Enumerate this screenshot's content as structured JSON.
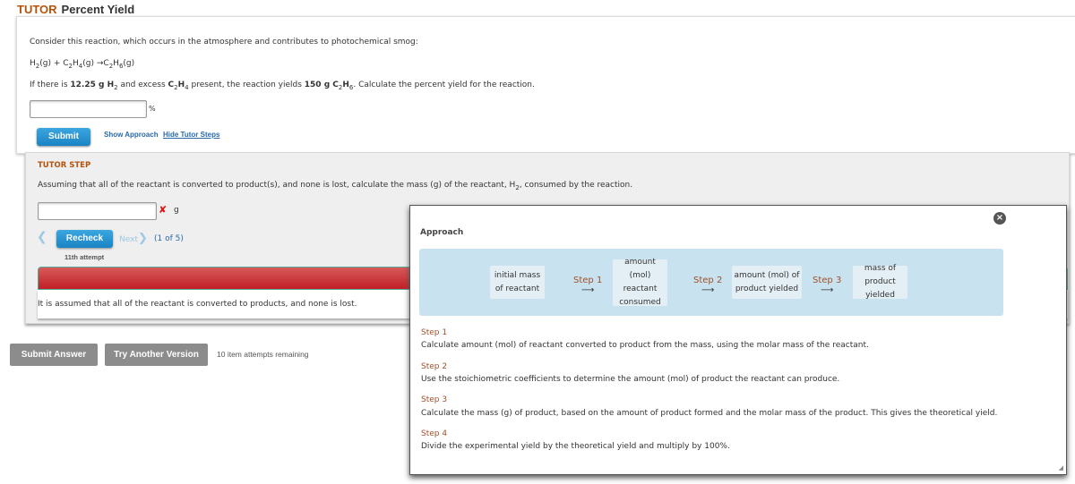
{
  "header": {
    "tag": "TUTOR",
    "title": "Percent Yield"
  },
  "question": {
    "intro": "Consider this reaction, which occurs in the atmosphere and contributes to photochemical smog:",
    "reaction": [
      [
        "H",
        0
      ],
      [
        "2",
        1
      ],
      [
        "(g) + C",
        0
      ],
      [
        "2",
        1
      ],
      [
        "H",
        0
      ],
      [
        "4",
        1
      ],
      [
        "(g) →C",
        0
      ],
      [
        "2",
        1
      ],
      [
        "H",
        0
      ],
      [
        "6",
        1
      ],
      [
        "(g)",
        0
      ]
    ],
    "prompt": [
      [
        "If there is ",
        0
      ],
      [
        "12.25 g H",
        2
      ],
      [
        "2",
        1
      ],
      [
        " and excess ",
        0
      ],
      [
        "C",
        2
      ],
      [
        "2",
        1
      ],
      [
        "H",
        2
      ],
      [
        "4",
        1
      ],
      [
        " present, the reaction yields ",
        0
      ],
      [
        "150 g C",
        2
      ],
      [
        "2",
        1
      ],
      [
        "H",
        2
      ],
      [
        "6",
        1
      ],
      [
        ". Calculate the percent yield for the reaction.",
        0
      ]
    ],
    "answer_value": "",
    "unit": "%",
    "submit_label": "Submit",
    "show_approach": "Show Approach",
    "hide_tutor_steps": "Hide Tutor Steps"
  },
  "tutor": {
    "heading": "TUTOR STEP",
    "prompt": [
      [
        "Assuming that all of the reactant is converted to product(s), and none is lost, calculate the mass (g) of the reactant, H",
        0
      ],
      [
        "2",
        1
      ],
      [
        ", consumed by the reaction.",
        0
      ]
    ],
    "answer_value": "",
    "error_mark": "✘",
    "unit": "g",
    "recheck_label": "Recheck",
    "next_label": "Next",
    "progress": "(1 of 5)",
    "attempt": "11th attempt",
    "feedback": "It is assumed that all of the reactant is converted to products, and none is lost."
  },
  "footer": {
    "submit_answer": "Submit Answer",
    "try_another": "Try Another Version",
    "attempts": "10 item attempts remaining"
  },
  "approach": {
    "title": "Approach",
    "flow": [
      "initial mass of reactant",
      "amount (mol) reactant consumed",
      "amount (mol) of product yielded",
      "mass of product yielded"
    ],
    "arrows": [
      "Step 1",
      "Step 2",
      "Step 3"
    ],
    "steps": [
      {
        "label": "Step 1",
        "text": "Calculate amount (mol) of reactant converted to product from the mass, using the molar mass of the reactant."
      },
      {
        "label": "Step 2",
        "text": "Use the stoichiometric coefficients to determine the amount (mol) of product the reactant can produce."
      },
      {
        "label": "Step 3",
        "text": "Calculate the mass (g) of product, based on the amount of product formed and the molar mass of the product. This gives the theoretical yield."
      },
      {
        "label": "Step 4",
        "text": "Divide the experimental yield by the theoretical yield and multiply by 100%."
      }
    ]
  },
  "colors": {
    "accent_orange": "#b5530b",
    "button_blue": "#1b83c4",
    "error_red": "#c01f26",
    "flow_bg": "#c9e2ef"
  }
}
